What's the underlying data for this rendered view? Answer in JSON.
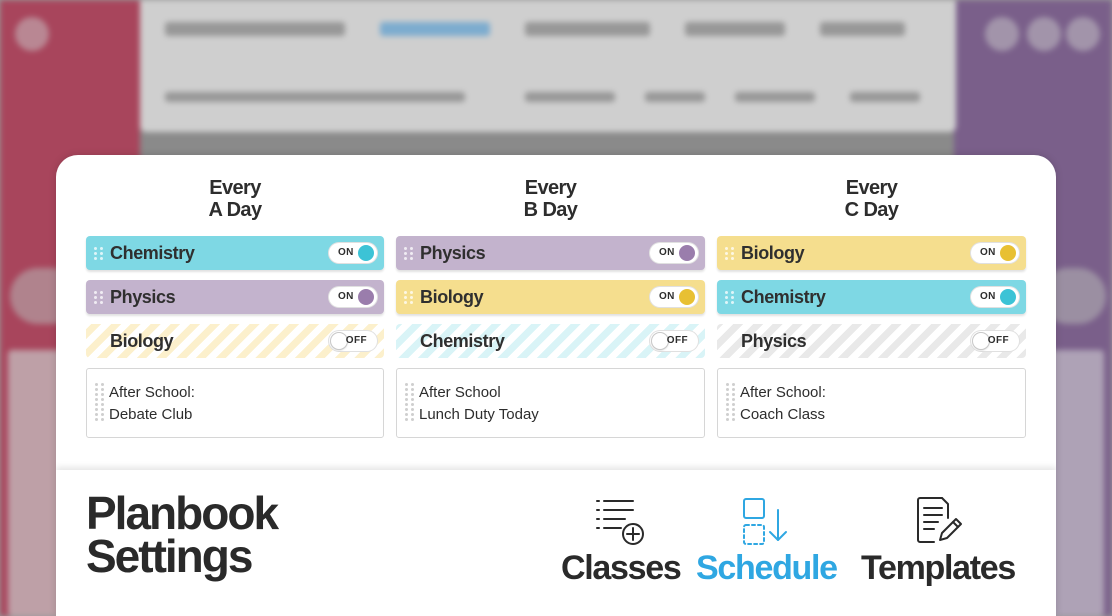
{
  "modal": {
    "columns": [
      {
        "title_line1": "Every",
        "title_line2": "A Day",
        "classes": [
          {
            "name": "Chemistry",
            "state": "ON",
            "color": "#7ed8e4"
          },
          {
            "name": "Physics",
            "state": "ON",
            "color": "#c3b3cd"
          },
          {
            "name": "Biology",
            "state": "OFF",
            "color": "#f5de8e"
          }
        ],
        "note_line1": "After School:",
        "note_line2": "Debate Club"
      },
      {
        "title_line1": "Every",
        "title_line2": "B Day",
        "classes": [
          {
            "name": "Physics",
            "state": "ON",
            "color": "#c3b3cd"
          },
          {
            "name": "Biology",
            "state": "ON",
            "color": "#f5de8e"
          },
          {
            "name": "Chemistry",
            "state": "OFF",
            "color": "#7ed8e4"
          }
        ],
        "note_line1": "After School",
        "note_line2": "Lunch Duty Today"
      },
      {
        "title_line1": "Every",
        "title_line2": "C Day",
        "classes": [
          {
            "name": "Biology",
            "state": "ON",
            "color": "#f5de8e"
          },
          {
            "name": "Chemistry",
            "state": "ON",
            "color": "#7ed8e4"
          },
          {
            "name": "Physics",
            "state": "OFF",
            "color": "#c3b3cd"
          }
        ],
        "note_line1": "After School:",
        "note_line2": "Coach Class"
      }
    ]
  },
  "footer": {
    "brand_line1": "Planbook",
    "brand_line2": "Settings",
    "nav": [
      {
        "label": "Classes",
        "icon": "list-add-icon",
        "active": false
      },
      {
        "label": "Schedule",
        "icon": "schedule-arrange-icon",
        "active": true
      },
      {
        "label": "Templates",
        "icon": "document-edit-icon",
        "active": false
      }
    ]
  },
  "colors": {
    "chemistry": "#7ed8e4",
    "physics": "#c3b3cd",
    "biology": "#f5de8e",
    "active_nav": "#2fa7e2"
  }
}
